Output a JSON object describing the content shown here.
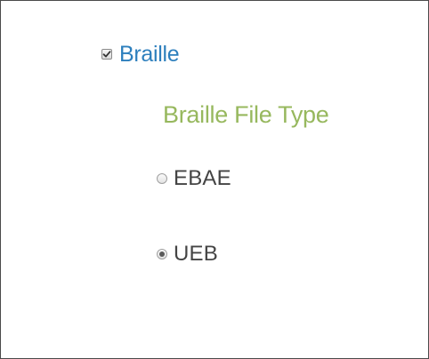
{
  "braille_option": {
    "label": "Braille",
    "checked": true
  },
  "file_type_section": {
    "title": "Braille File Type",
    "options": [
      {
        "label": "EBAE",
        "selected": false
      },
      {
        "label": "UEB",
        "selected": true
      }
    ]
  },
  "colors": {
    "checkbox_label": "#2d7fbd",
    "section_title": "#97b85e",
    "radio_label": "#444444",
    "border": "#4a4a4a"
  },
  "icons": {
    "checkbox": "checkmark-icon",
    "radio_selected": "radio-dot-icon"
  }
}
